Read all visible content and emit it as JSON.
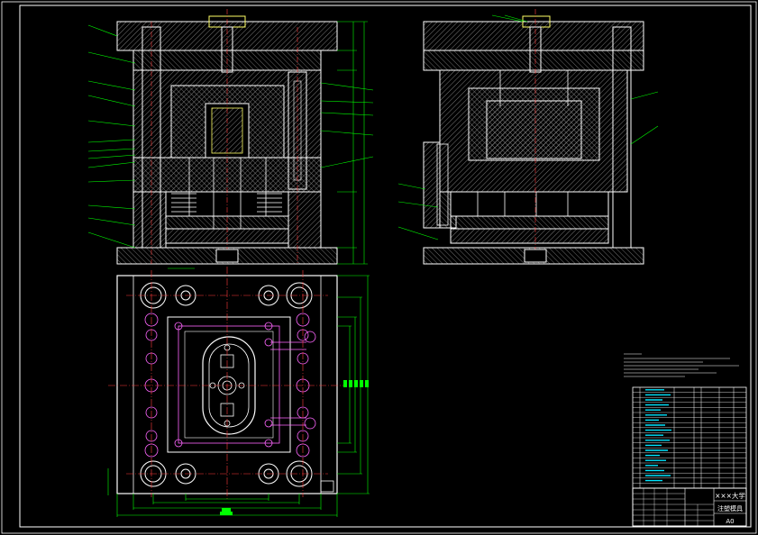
{
  "title_block": {
    "school": "×××大学",
    "drawing_name": "注塑模具",
    "sheet_size": "A0"
  },
  "colors": {
    "background": "#000000",
    "outline": "#ffffff",
    "dimension": "#00ff00",
    "centerline": "#ff3b3b",
    "annotation": "#00e5ff",
    "hatch": "#9a9a9a",
    "part": "#ffff66",
    "bolt": "#ff66ff"
  }
}
